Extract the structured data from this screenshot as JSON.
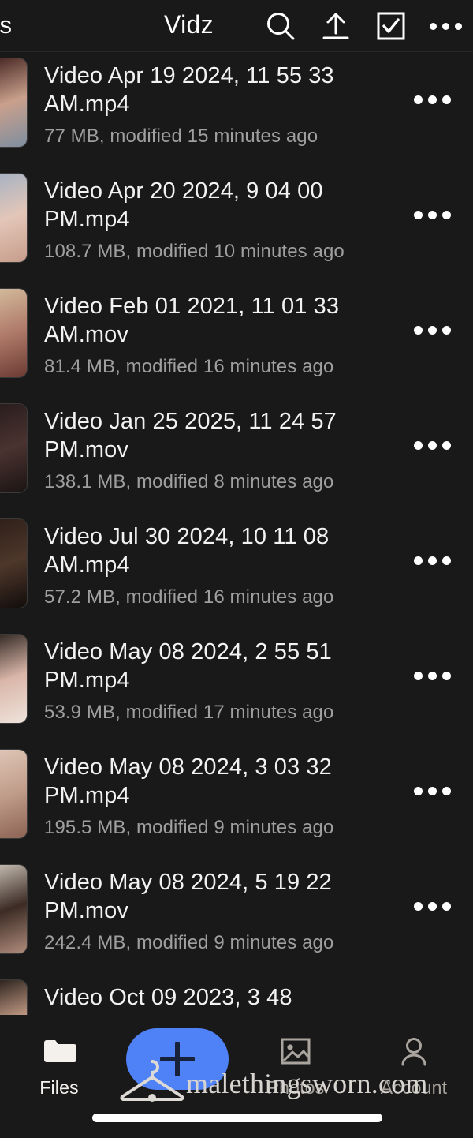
{
  "header": {
    "back_label": "es",
    "title": "Vidz",
    "icons": {
      "search": "search-icon",
      "upload": "upload-icon",
      "select": "checkbox-select-icon",
      "more": "more-options-icon"
    }
  },
  "files": [
    {
      "name": "Video Apr 19 2024, 11 55 33 AM.mp4",
      "meta": "77 MB, modified 15 minutes ago",
      "size": "77 MB",
      "modified": "15 minutes ago",
      "type": "mp4",
      "thumb_colors": [
        "#3a1a18",
        "#c9a08c",
        "#7f8ea0"
      ]
    },
    {
      "name": "Video Apr 20 2024, 9 04 00 PM.mp4",
      "meta": "108.7 MB, modified 10 minutes ago",
      "size": "108.7 MB",
      "modified": "10 minutes ago",
      "type": "mp4",
      "thumb_colors": [
        "#9fb0c4",
        "#e3c6b8",
        "#c79d8b"
      ]
    },
    {
      "name": "Video Feb 01 2021, 11 01 33 AM.mov",
      "meta": "81.4 MB, modified 16 minutes ago",
      "size": "81.4 MB",
      "modified": "16 minutes ago",
      "type": "mov",
      "thumb_colors": [
        "#d8c3a2",
        "#b07b6a",
        "#6d3b34"
      ]
    },
    {
      "name": "Video Jan 25 2025, 11 24 57 PM.mov",
      "meta": "138.1 MB, modified 8 minutes ago",
      "size": "138.1 MB",
      "modified": "8 minutes ago",
      "type": "mov",
      "thumb_colors": [
        "#241a1a",
        "#4a3330",
        "#1b1413"
      ]
    },
    {
      "name": "Video Jul 30 2024, 10 11 08 AM.mp4",
      "meta": "57.2 MB, modified 16 minutes ago",
      "size": "57.2 MB",
      "modified": "16 minutes ago",
      "type": "mp4",
      "thumb_colors": [
        "#2a1d17",
        "#4e372b",
        "#120d0b"
      ]
    },
    {
      "name": "Video May 08 2024, 2 55 51 PM.mp4",
      "meta": "53.9 MB, modified 17 minutes ago",
      "size": "53.9 MB",
      "modified": "17 minutes ago",
      "type": "mp4",
      "thumb_colors": [
        "#1d1613",
        "#d9b6a8",
        "#efe3dc"
      ]
    },
    {
      "name": "Video May 08 2024, 3 03 32 PM.mp4",
      "meta": "195.5 MB, modified 9 minutes ago",
      "size": "195.5 MB",
      "modified": "9 minutes ago",
      "type": "mp4",
      "thumb_colors": [
        "#e2cbbc",
        "#c19d8b",
        "#8c6354"
      ]
    },
    {
      "name": "Video May 08 2024, 5 19 22 PM.mov",
      "meta": "242.4 MB, modified 9 minutes ago",
      "size": "242.4 MB",
      "modified": "9 minutes ago",
      "type": "mov",
      "thumb_colors": [
        "#d6cec2",
        "#3b2b24",
        "#b08c7c"
      ]
    },
    {
      "name": "Video Oct 09 2023, 3 48",
      "meta": "",
      "size": "",
      "modified": "",
      "type": "",
      "thumb_colors": [
        "#17120f",
        "#caa08a",
        "#241a16"
      ]
    }
  ],
  "bottom_nav": {
    "items": [
      {
        "label": "Files",
        "icon": "folder-icon",
        "active": true
      },
      {
        "label": "Photos",
        "icon": "photo-icon",
        "active": false
      },
      {
        "label": "Account",
        "icon": "person-icon",
        "active": false
      }
    ],
    "fab": {
      "icon": "plus-icon",
      "color": "#4f82f7"
    }
  },
  "watermark": {
    "text": "malethingsworn.com",
    "logo": "clothes-hanger-icon"
  },
  "colors": {
    "background": "#191919",
    "primary_text": "#f2f2f2",
    "secondary_text": "#9f9f9f",
    "accent": "#4f82f7",
    "nav_inactive": "#a9a49e"
  }
}
